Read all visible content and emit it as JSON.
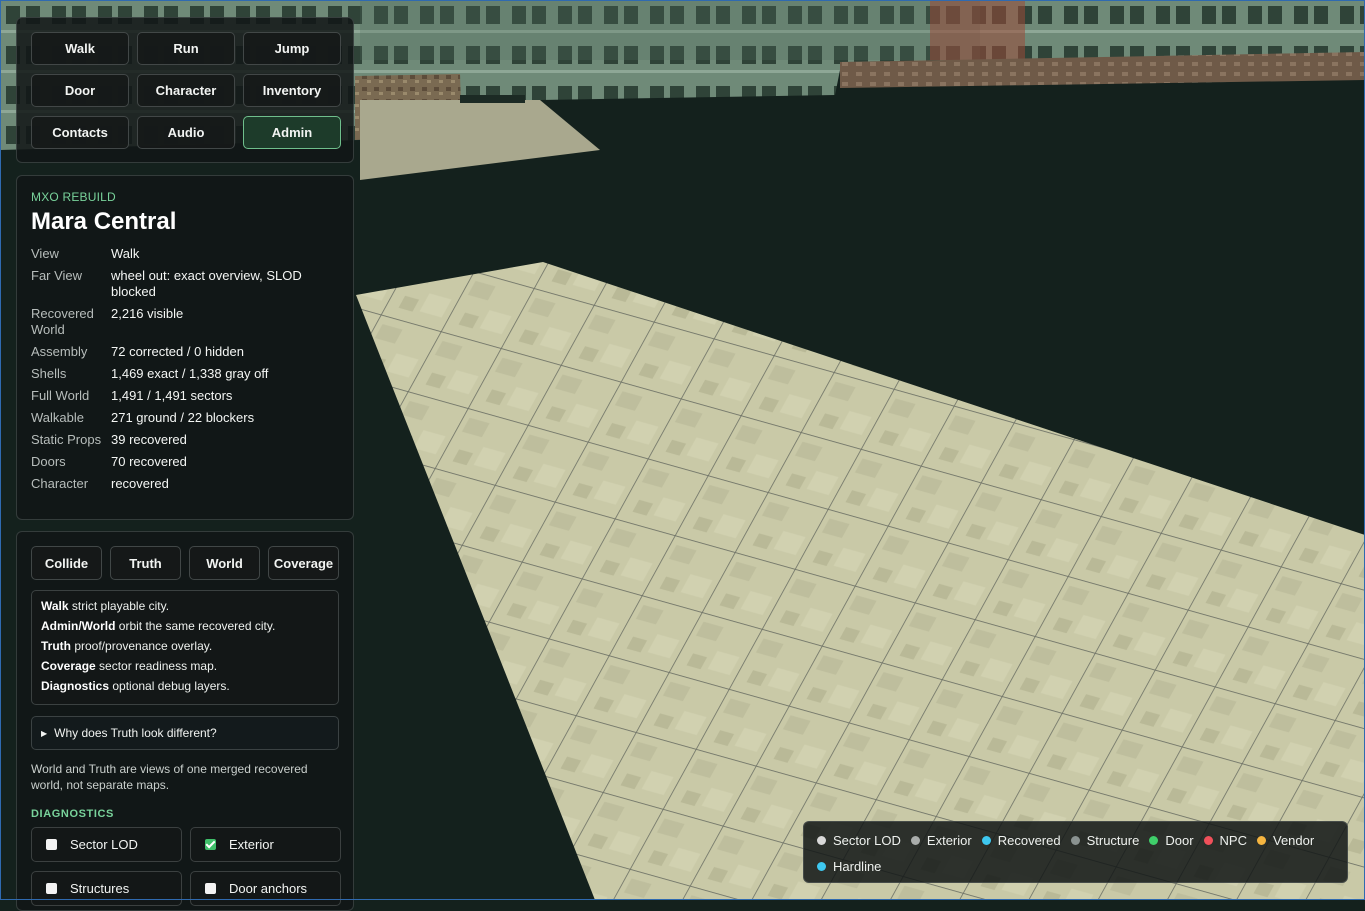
{
  "nav": {
    "buttons": [
      "Walk",
      "Run",
      "Jump",
      "Door",
      "Character",
      "Inventory",
      "Contacts",
      "Audio",
      "Admin"
    ],
    "active": "Admin"
  },
  "info": {
    "kicker": "MXO REBUILD",
    "title": "Mara Central",
    "rows": [
      {
        "label": "View",
        "value": "Walk"
      },
      {
        "label": "Far View",
        "value": "wheel out: exact overview, SLOD blocked"
      },
      {
        "label": "Recovered World",
        "value": "2,216 visible"
      },
      {
        "label": "Assembly",
        "value": "72 corrected / 0 hidden"
      },
      {
        "label": "Shells",
        "value": "1,469 exact / 1,338 gray off"
      },
      {
        "label": "Full World",
        "value": "1,491 / 1,491 sectors"
      },
      {
        "label": "Walkable",
        "value": "271 ground / 22 blockers"
      },
      {
        "label": "Static Props",
        "value": "39 recovered"
      },
      {
        "label": "Doors",
        "value": "70 recovered"
      },
      {
        "label": "Character",
        "value": "recovered"
      }
    ]
  },
  "tools": {
    "tabs": [
      "Collide",
      "Truth",
      "World",
      "Coverage"
    ],
    "modes": [
      {
        "name": "Walk",
        "desc": " strict playable city."
      },
      {
        "name": "Admin/World",
        "desc": " orbit the same recovered city."
      },
      {
        "name": "Truth",
        "desc": " proof/provenance overlay."
      },
      {
        "name": "Coverage",
        "desc": " sector readiness map."
      },
      {
        "name": "Diagnostics",
        "desc": " optional debug layers."
      }
    ],
    "details_label": "Why does Truth look different?",
    "details_icon": "triangle-right-icon",
    "note": "World and Truth are views of one merged recovered world, not separate maps.",
    "diagnostics_heading": "DIAGNOSTICS",
    "checks": [
      {
        "label": "Sector LOD",
        "checked": false
      },
      {
        "label": "Exterior",
        "checked": true
      },
      {
        "label": "Structures",
        "checked": false
      },
      {
        "label": "Door anchors",
        "checked": false
      }
    ]
  },
  "legend": [
    {
      "label": "Sector LOD",
      "color": "#d9d9d9"
    },
    {
      "label": "Exterior",
      "color": "#a9adab"
    },
    {
      "label": "Recovered",
      "color": "#3ec8f0"
    },
    {
      "label": "Structure",
      "color": "#8a9290"
    },
    {
      "label": "Door",
      "color": "#3fcf6a"
    },
    {
      "label": "NPC",
      "color": "#f0505a"
    },
    {
      "label": "Vendor",
      "color": "#f5b540"
    },
    {
      "label": "Hardline",
      "color": "#3ec8f0"
    }
  ],
  "colors": {
    "accent": "#79d39b",
    "active_button_bg": "#1d3b2a",
    "void": "#14211d"
  }
}
